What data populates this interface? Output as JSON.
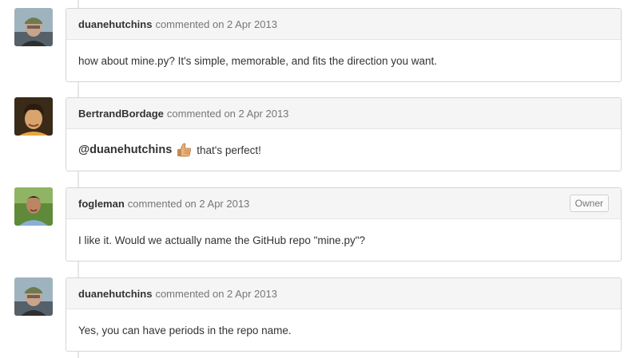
{
  "comments": [
    {
      "author": "duanehutchins",
      "action": "commented on 2 Apr 2013",
      "body": "how about mine.py? It's simple, memorable, and fits the direction you want."
    },
    {
      "author": "BertrandBordage",
      "action": "commented on 2 Apr 2013",
      "mention": "@duanehutchins",
      "emoji": "thumbs-up-icon",
      "body": "that's perfect!"
    },
    {
      "author": "fogleman",
      "action": "commented on 2 Apr 2013",
      "badge": "Owner",
      "body": "I like it. Would we actually name the GitHub repo \"mine.py\"?"
    },
    {
      "author": "duanehutchins",
      "action": "commented on 2 Apr 2013",
      "body": "Yes, you can have periods in the repo name."
    }
  ]
}
